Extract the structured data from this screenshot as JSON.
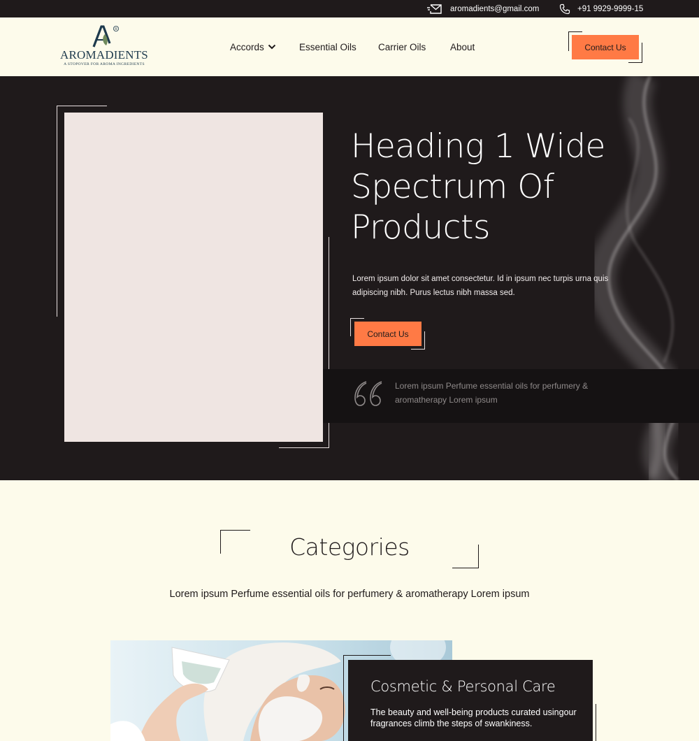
{
  "topbar": {
    "email": "aromadients@gmail.com",
    "phone": "+91 9929-9999-15",
    "email_icon": "mail-icon",
    "phone_icon": "phone-icon"
  },
  "brand": {
    "name": "AROMADIENTS",
    "tagline": "A STOPOVER FOR AROMA INGREDIENTS",
    "registered_mark": "®"
  },
  "nav": {
    "items": [
      {
        "label": "Accords",
        "has_dropdown": true
      },
      {
        "label": "Essential Oils"
      },
      {
        "label": "Carrier Oils"
      },
      {
        "label": "About"
      }
    ],
    "contact_label": "Contact Us"
  },
  "hero": {
    "title": "Heading 1 Wide Spectrum Of Products",
    "description": "Lorem ipsum dolor sit amet consectetur. Id in ipsum nec turpis urna quis adipiscing nibh. Purus lectus nibh massa sed.",
    "contact_label": "Contact Us",
    "quote": "Lorem ipsum Perfume essential oils for perfumery & aromatherapy Lorem ipsum"
  },
  "categories": {
    "title": "Categories",
    "subtitle": "Lorem ipsum Perfume essential oils for perfumery & aromatherapy Lorem ipsum",
    "items": [
      {
        "title": "Cosmetic & Personal Care",
        "description": "The beauty and well-being products curated usingour fragrances climb the steps of swankiness."
      }
    ]
  },
  "colors": {
    "dark": "#1f1a1b",
    "accent": "#ff7a45",
    "cream": "#fdfbeb",
    "placeholder": "#efe5e2"
  }
}
